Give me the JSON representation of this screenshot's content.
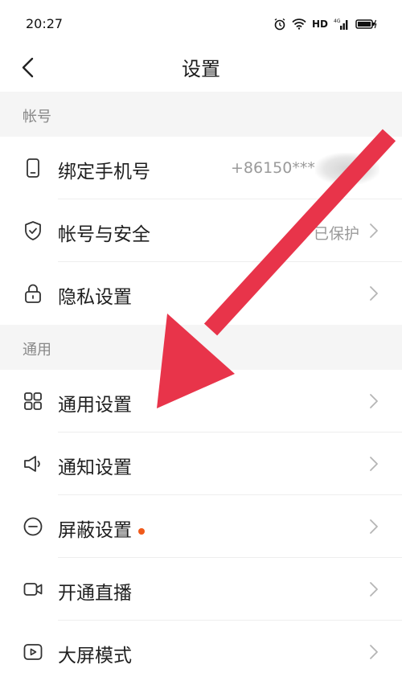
{
  "status_bar": {
    "time": "20:27",
    "hd": "HD"
  },
  "nav": {
    "title": "设置"
  },
  "sections": [
    {
      "title": "帐号"
    },
    {
      "title": "通用"
    }
  ],
  "account_items": [
    {
      "label": "绑定手机号",
      "value": "+86150***",
      "icon": "phone-icon"
    },
    {
      "label": "帐号与安全",
      "value": "已保护",
      "icon": "shield-check-icon"
    },
    {
      "label": "隐私设置",
      "value": "",
      "icon": "lock-icon"
    }
  ],
  "general_items": [
    {
      "label": "通用设置",
      "icon": "grid-icon"
    },
    {
      "label": "通知设置",
      "icon": "speaker-icon"
    },
    {
      "label": "屏蔽设置",
      "icon": "block-icon",
      "badge": true
    },
    {
      "label": "开通直播",
      "icon": "video-camera-icon"
    },
    {
      "label": "大屏模式",
      "icon": "play-icon"
    }
  ],
  "colors": {
    "arrow": "#e8344a",
    "dot": "#f05a1a",
    "section_bg": "#f5f5f5"
  }
}
